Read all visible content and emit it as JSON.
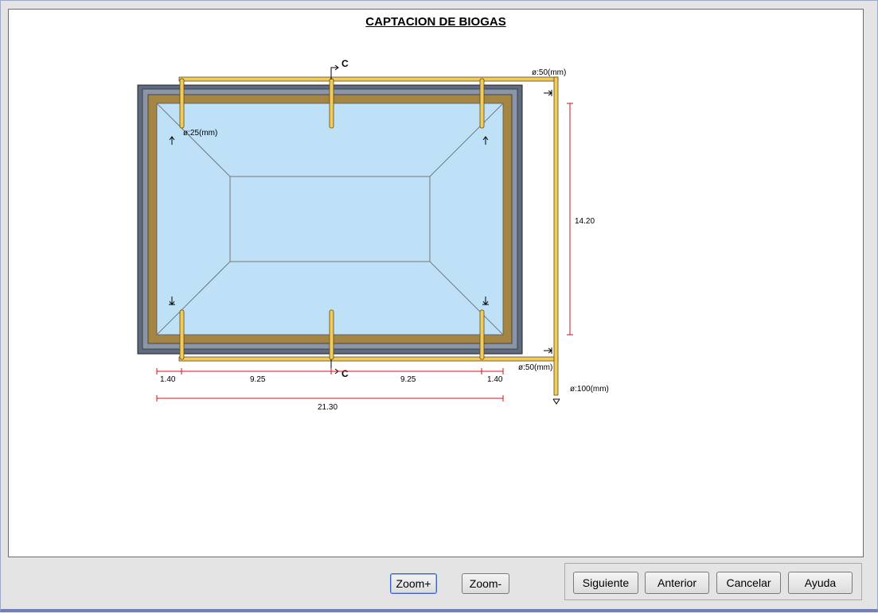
{
  "window": {
    "title": "CAPTACION DE BIOGAS"
  },
  "drawing": {
    "section_label": "C",
    "pipe_main_top": "ø:50(mm)",
    "pipe_main_bottom": "ø:50(mm)",
    "pipe_branch": "ø:25(mm)",
    "pipe_outlet": "ø:100(mm)",
    "dim_height": "14.20",
    "dim_segments": [
      "1.40",
      "9.25",
      "9.25",
      "1.40"
    ],
    "dim_total": "21.30",
    "colors": {
      "pit_fill": "#bfe1f8",
      "pipe": "#f2cb59",
      "pipe_edge": "#5b4a14",
      "wall_brown": "#a48543",
      "wall_slate": "#5f6b80",
      "dim_red": "#d0101a"
    }
  },
  "toolbar": {
    "zoom_in": "Zoom+",
    "zoom_out": "Zoom-",
    "next": "Siguiente",
    "previous": "Anterior",
    "cancel": "Cancelar",
    "help": "Ayuda"
  }
}
